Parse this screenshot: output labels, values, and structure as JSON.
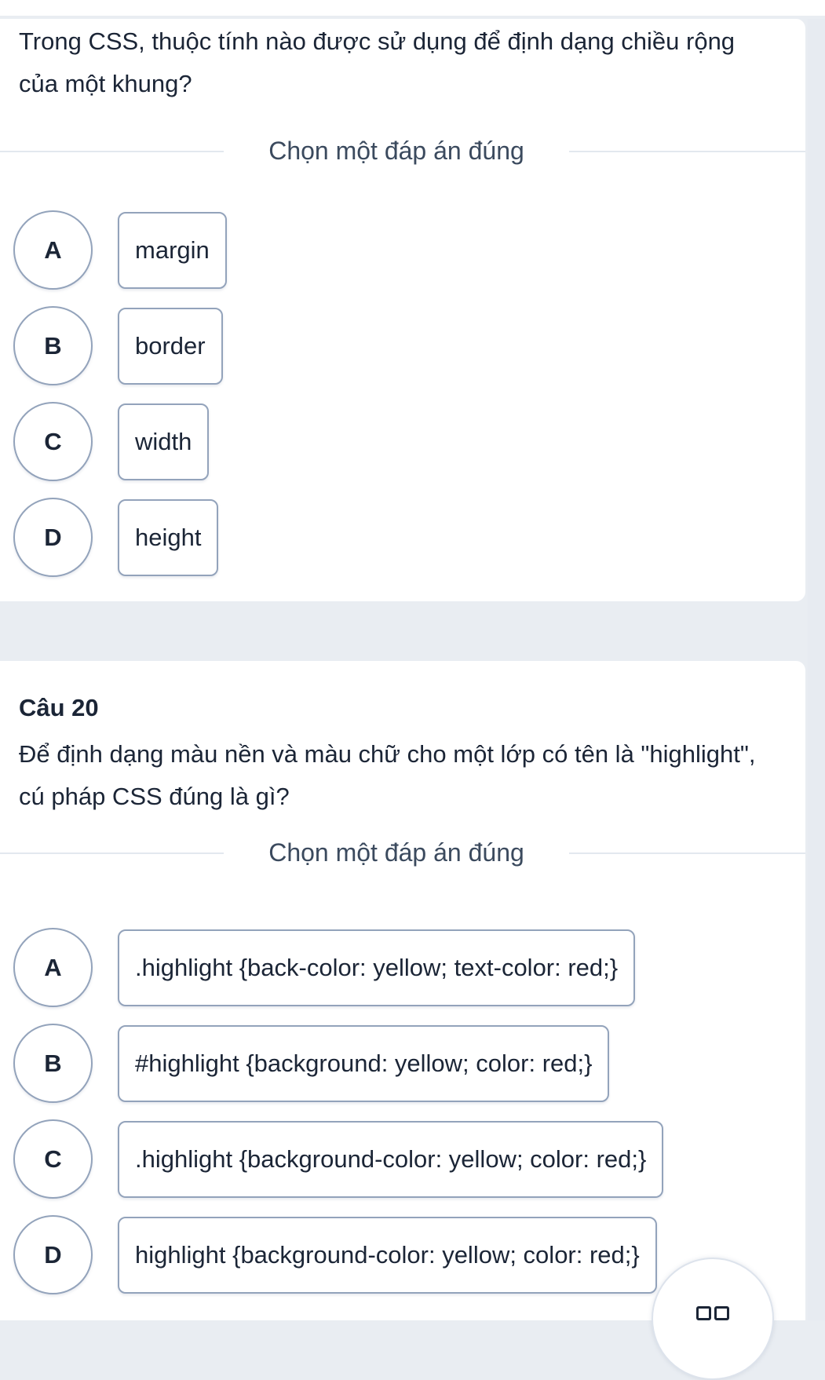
{
  "colors": {
    "background": "#e9edf2",
    "card": "#ffffff",
    "text": "#1b2536",
    "border": "#93a3bb",
    "divider": "#e3e8ef"
  },
  "questions": [
    {
      "number": "",
      "text": "Trong CSS, thuộc tính nào được sử dụng để định dạng chiều rộng của một khung?",
      "instruction": "Chọn một đáp án đúng",
      "options": [
        {
          "letter": "A",
          "text": "margin"
        },
        {
          "letter": "B",
          "text": "border"
        },
        {
          "letter": "C",
          "text": "width"
        },
        {
          "letter": "D",
          "text": "height"
        }
      ]
    },
    {
      "number": "Câu 20",
      "text": "Để định dạng màu nền và màu chữ cho một lớp có tên là \"highlight\", cú pháp CSS đúng là gì?",
      "instruction": "Chọn một đáp án đúng",
      "options": [
        {
          "letter": "A",
          "text": ".highlight {back-color: yellow; text-color: red;}"
        },
        {
          "letter": "B",
          "text": "#highlight {background: yellow; color: red;}"
        },
        {
          "letter": "C",
          "text": ".highlight {background-color: yellow; color: red;}"
        },
        {
          "letter": "D",
          "text": "highlight {background-color: yellow; color: red;}"
        }
      ]
    }
  ],
  "floating_button": {
    "icon": "grid-squares-icon"
  }
}
